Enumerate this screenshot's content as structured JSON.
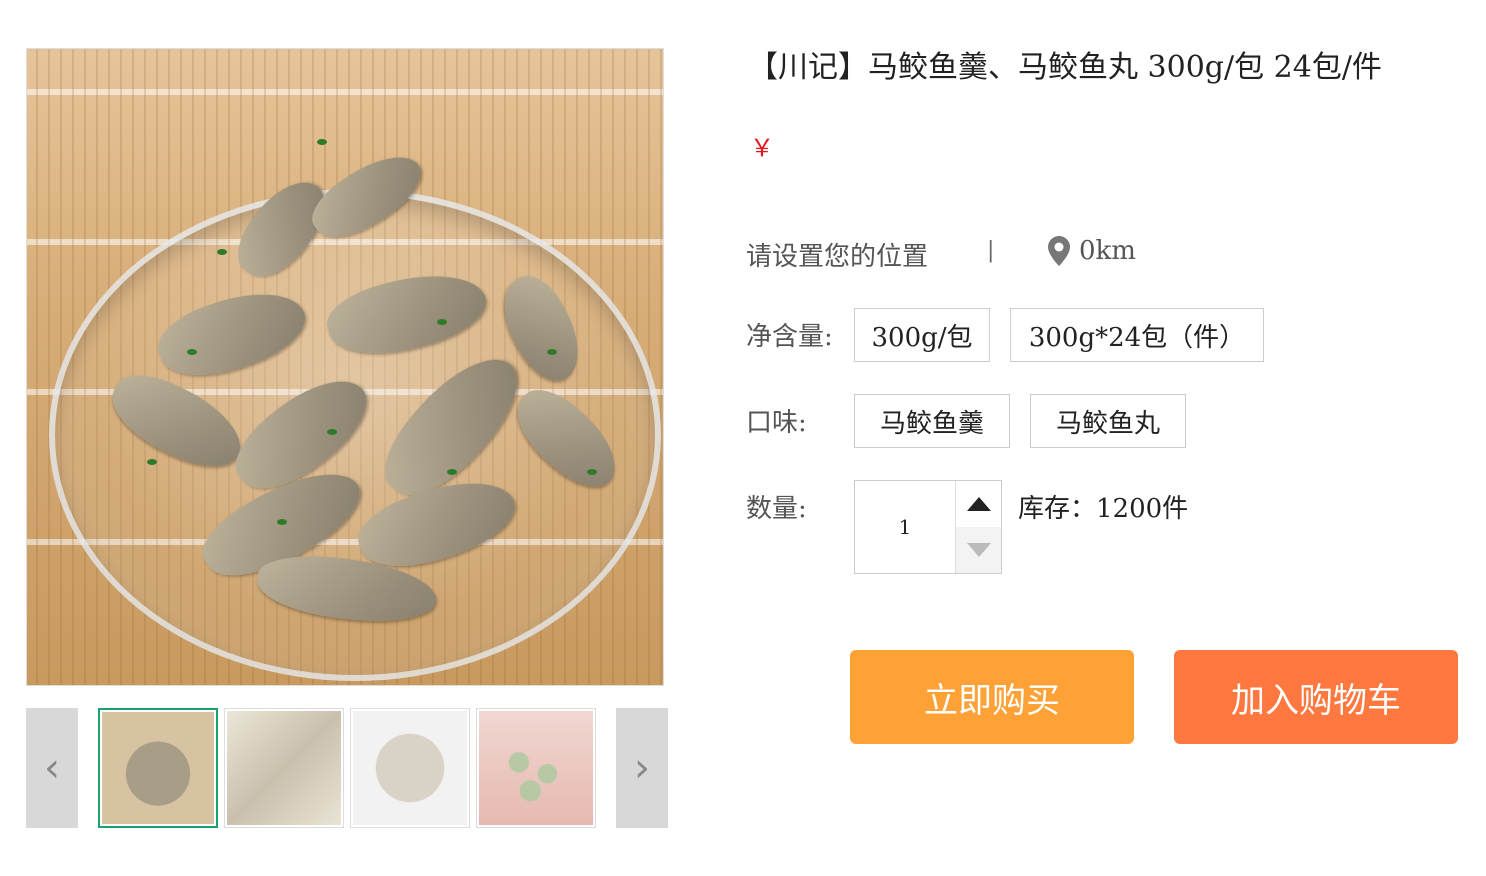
{
  "product": {
    "title": "【川记】马鲛鱼羹、马鲛鱼丸 300g/包 24包/件",
    "price": "￥"
  },
  "location": {
    "label": "请设置您的位置",
    "separator": "|",
    "distance": "0km",
    "icon": "location-pin-icon"
  },
  "net_weight": {
    "label": "净含量:",
    "options": [
      "300g/包",
      "300g*24包（件）"
    ]
  },
  "flavor": {
    "label": "口味:",
    "options": [
      "马鲛鱼羹",
      "马鲛鱼丸"
    ]
  },
  "quantity": {
    "label": "数量:",
    "value": "1",
    "stock": "库存：1200件"
  },
  "actions": {
    "buy_now": "立即购买",
    "add_to_cart": "加入购物车"
  },
  "gallery": {
    "prev": "‹",
    "next": "›"
  },
  "colors": {
    "price": "#e4141e",
    "buy_now": "#fea237",
    "add_to_cart": "#fe7840",
    "active_thumb_border": "#1aa36b"
  }
}
